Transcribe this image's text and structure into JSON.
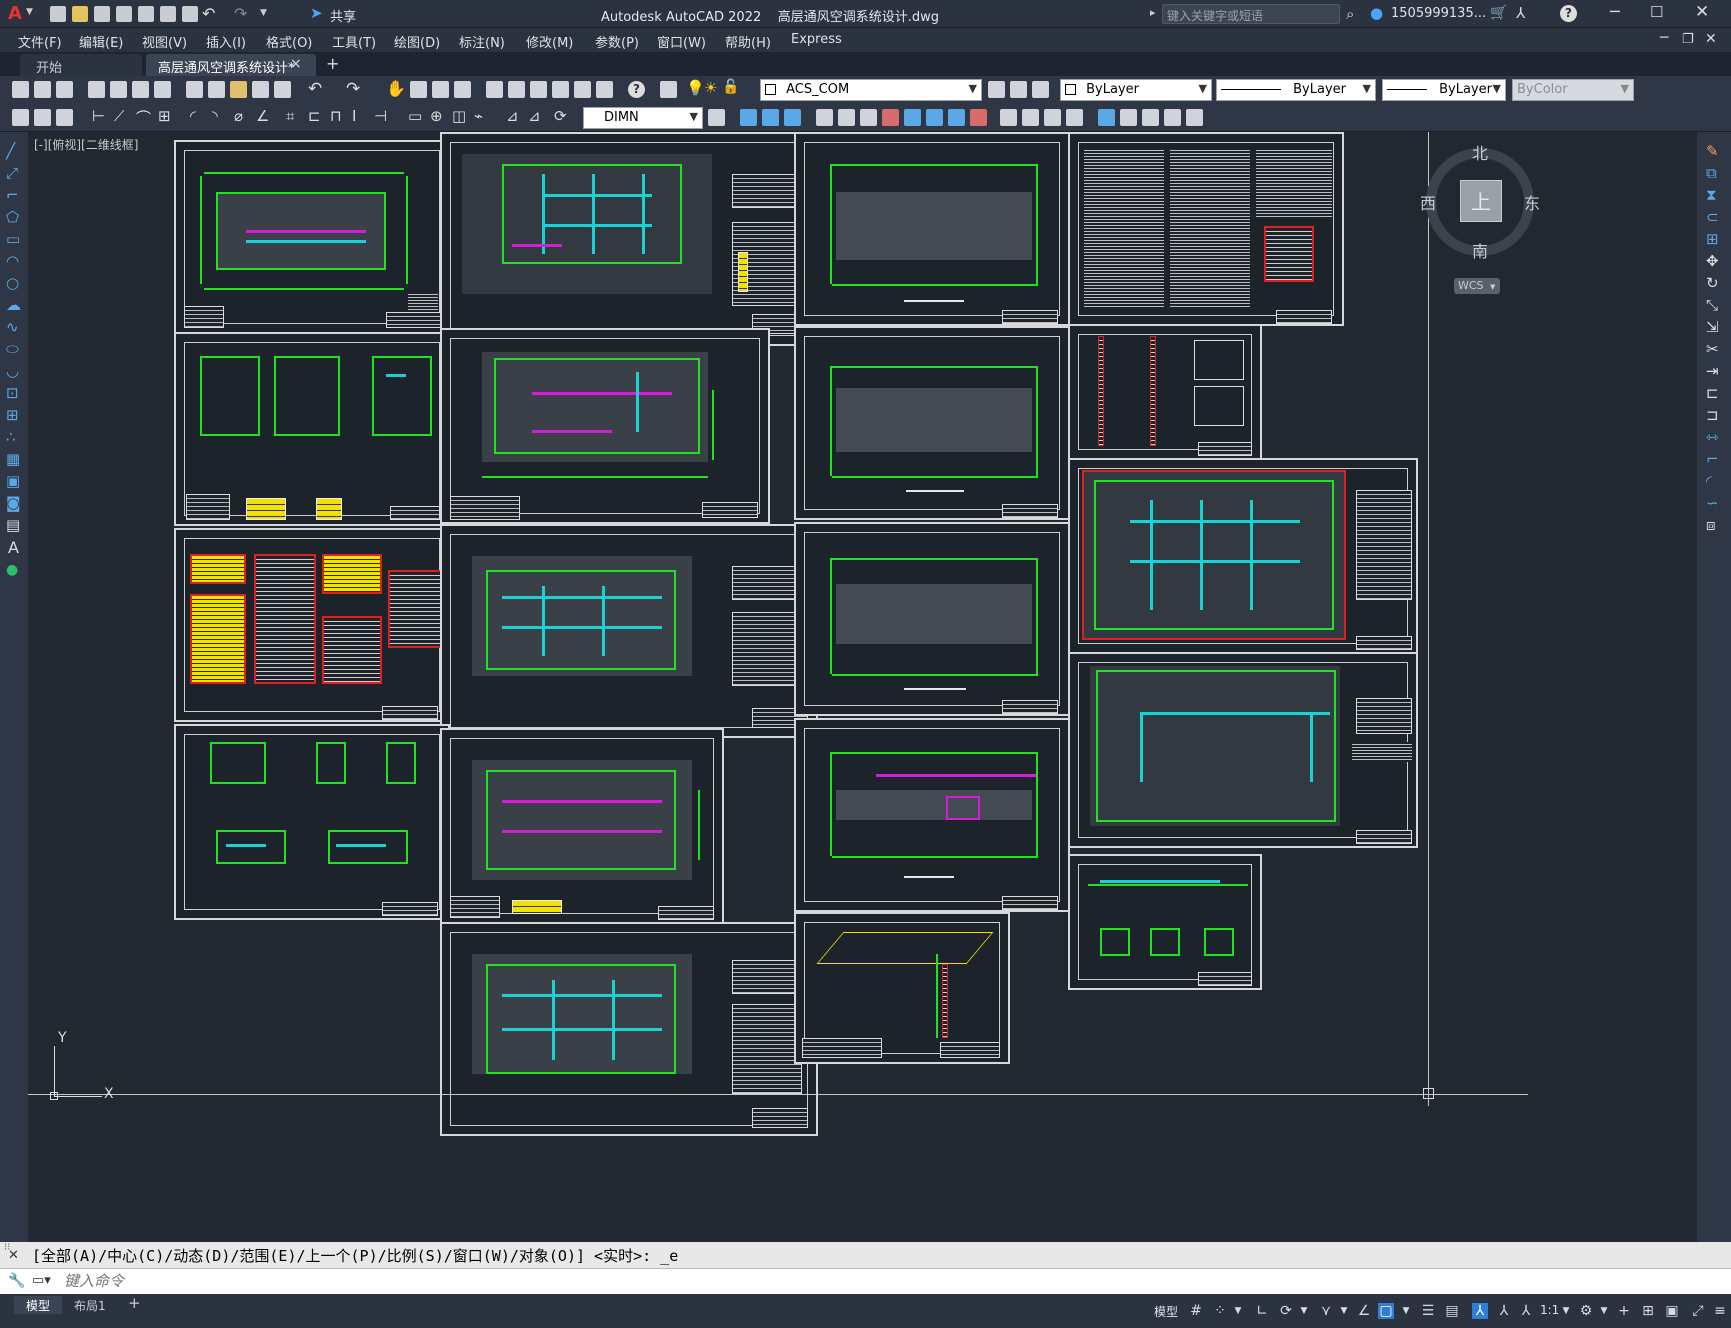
{
  "titlebar": {
    "app_letter": "A",
    "share_label": "共享",
    "title": "Autodesk AutoCAD 2022    高层通风空调系统设计.dwg",
    "search_placeholder": "键入关键字或短语",
    "user": "1505999135...",
    "help_label": "?"
  },
  "menubar": {
    "items": [
      "文件(F)",
      "编辑(E)",
      "视图(V)",
      "插入(I)",
      "格式(O)",
      "工具(T)",
      "绘图(D)",
      "标注(N)",
      "修改(M)",
      "参数(P)",
      "窗口(W)",
      "帮助(H)",
      "Express"
    ]
  },
  "tabs": {
    "start": "开始",
    "active": "高层通风空调系统设计*",
    "close": "×",
    "add": "+"
  },
  "toolbar": {
    "layer_value": "ACS_COM",
    "color_value": "ByLayer",
    "linetype_value": "ByLayer",
    "lineweight_value": "ByLayer",
    "plotstyle_value": "ByColor",
    "dimstyle_value": "DIMN"
  },
  "viewport": {
    "label": "[-][俯视][二维线框]"
  },
  "viewcube": {
    "north": "北",
    "south": "南",
    "east": "东",
    "west": "西",
    "top": "上",
    "wcs": "WCS"
  },
  "ucs": {
    "x": "X",
    "y": "Y"
  },
  "command": {
    "history": "[全部(A)/中心(C)/动态(D)/范围(E)/上一个(P)/比例(S)/窗口(W)/对象(O)] <实时>: _e",
    "placeholder": "键入命令"
  },
  "statusbar": {
    "model_tab": "模型",
    "layout_tab": "布局1",
    "add": "+",
    "model_label": "模型",
    "scale": "1:1"
  },
  "colors": {
    "accent_blue": "#2e7dd7",
    "line_green": "#22e022",
    "duct_cyan": "#19d3d3",
    "pipe_magenta": "#d81bd8",
    "table_yellow": "#f2e200",
    "frame_red": "#e02020"
  }
}
